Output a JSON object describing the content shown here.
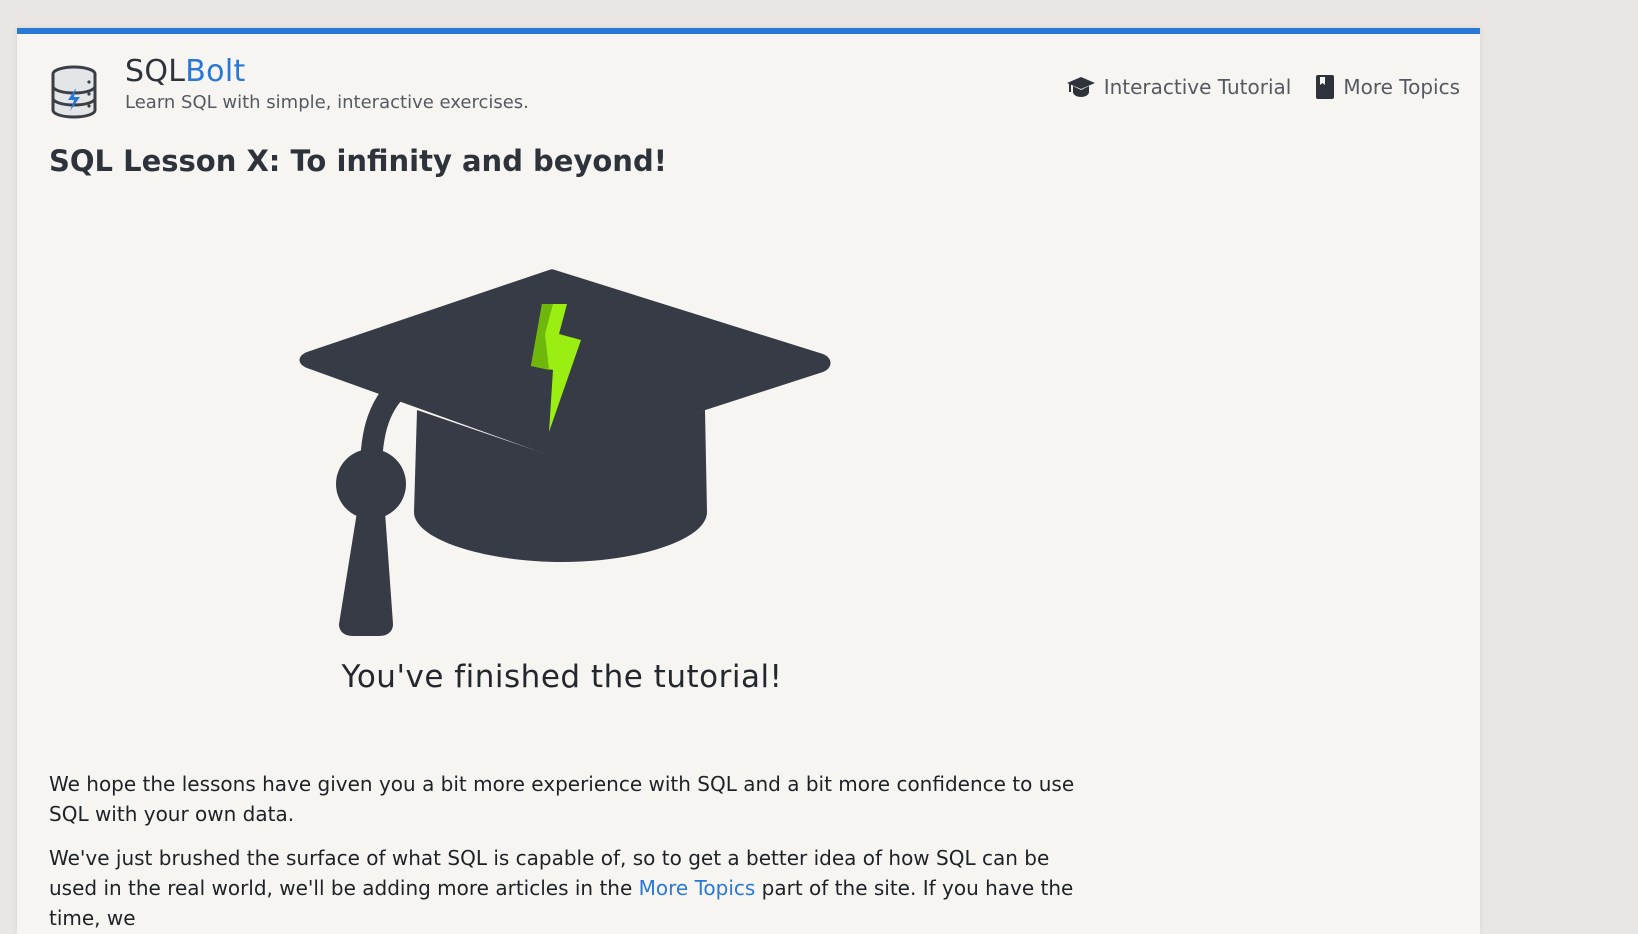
{
  "brand": {
    "name_part1": "SQL",
    "name_part2": "Bolt",
    "tagline": "Learn SQL with simple, interactive exercises.",
    "accent_color": "#2a78d6",
    "logo_icon": "database-bolt-icon"
  },
  "nav": {
    "items": [
      {
        "label": "Interactive Tutorial",
        "icon": "graduation-cap-icon"
      },
      {
        "label": "More Topics",
        "icon": "book-icon"
      }
    ]
  },
  "lesson": {
    "title": "SQL Lesson X: To infinity and beyond!",
    "hero_icon": "graduation-cap-bolt-icon",
    "finished_message": "You've finished the tutorial!",
    "paragraph1": "We hope the lessons have given you a bit more experience with SQL and a bit more confidence to use SQL with your own data.",
    "paragraph2_before_link": "We've just brushed the surface of what SQL is capable of, so to get a better idea of how SQL can be used in the real world, we'll be adding more articles in the ",
    "paragraph2_link": "More Topics",
    "paragraph2_after_link": " part of the site. If you have the time, we"
  }
}
